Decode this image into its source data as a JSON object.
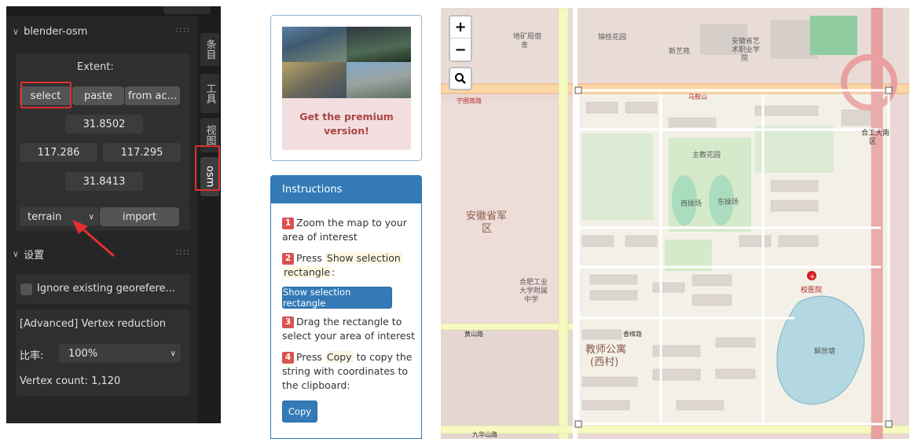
{
  "blender": {
    "side_tabs": [
      "条目",
      "工具",
      "视图",
      "osm"
    ],
    "panel_title": "blender-osm",
    "extent_label": "Extent:",
    "extent_buttons": [
      "select",
      "paste",
      "from ac..."
    ],
    "coords": {
      "north": "31.8502",
      "west": "117.286",
      "east": "117.295",
      "south": "31.8413"
    },
    "data_type": "terrain",
    "import_label": "import",
    "settings_title": "设置",
    "ignore_georef_label": "Ignore existing georefere...",
    "vertex_reduction_label": "[Advanced] Vertex reduction",
    "ratio_label": "比率:",
    "ratio_value": "100%",
    "vertex_count": "Vertex count: 1,120"
  },
  "premium": {
    "text_line1": "Get the premium",
    "text_line2": "version!"
  },
  "instructions": {
    "title": "Instructions",
    "step1": {
      "num": "1",
      "text": "Zoom the map to your area of interest"
    },
    "step2": {
      "num": "2",
      "pre": "Press",
      "hl1": "Show selection",
      "hl2": "rectangle",
      "post": ":"
    },
    "show_button": "Show selection rectangle",
    "step3": {
      "num": "3",
      "text": "Drag the rectangle to select your area of interest"
    },
    "step4": {
      "num": "4",
      "pre": "Press",
      "hl": "Copy",
      "post": "to copy the string with coordinates to the clipboard:"
    },
    "copy_button": "Copy"
  },
  "map": {
    "zoom_in": "+",
    "zoom_out": "−",
    "labels": {
      "l1": "安徽省军",
      "l2": "区",
      "l3": "教师公寓",
      "l4": "(西村)",
      "l5": "西操场",
      "l6": "东操场",
      "l7": "合肥工业",
      "l8": "大学附属",
      "l9": "中学",
      "l10": "黄山路",
      "l11": "九华山路",
      "l12": "宁国南路",
      "l13": "安徽省艺",
      "l14": "术职业学",
      "l15": "院",
      "l16": "合工大南",
      "l17": "区",
      "l18": "校医院",
      "l19": "新艺苑",
      "l20": "地矿局宿",
      "l21": "舍",
      "l22": "锦桂花园",
      "l23": "主教花园",
      "l24": "解放塘",
      "l25": "香樟路",
      "l26": "马鞍山"
    }
  }
}
